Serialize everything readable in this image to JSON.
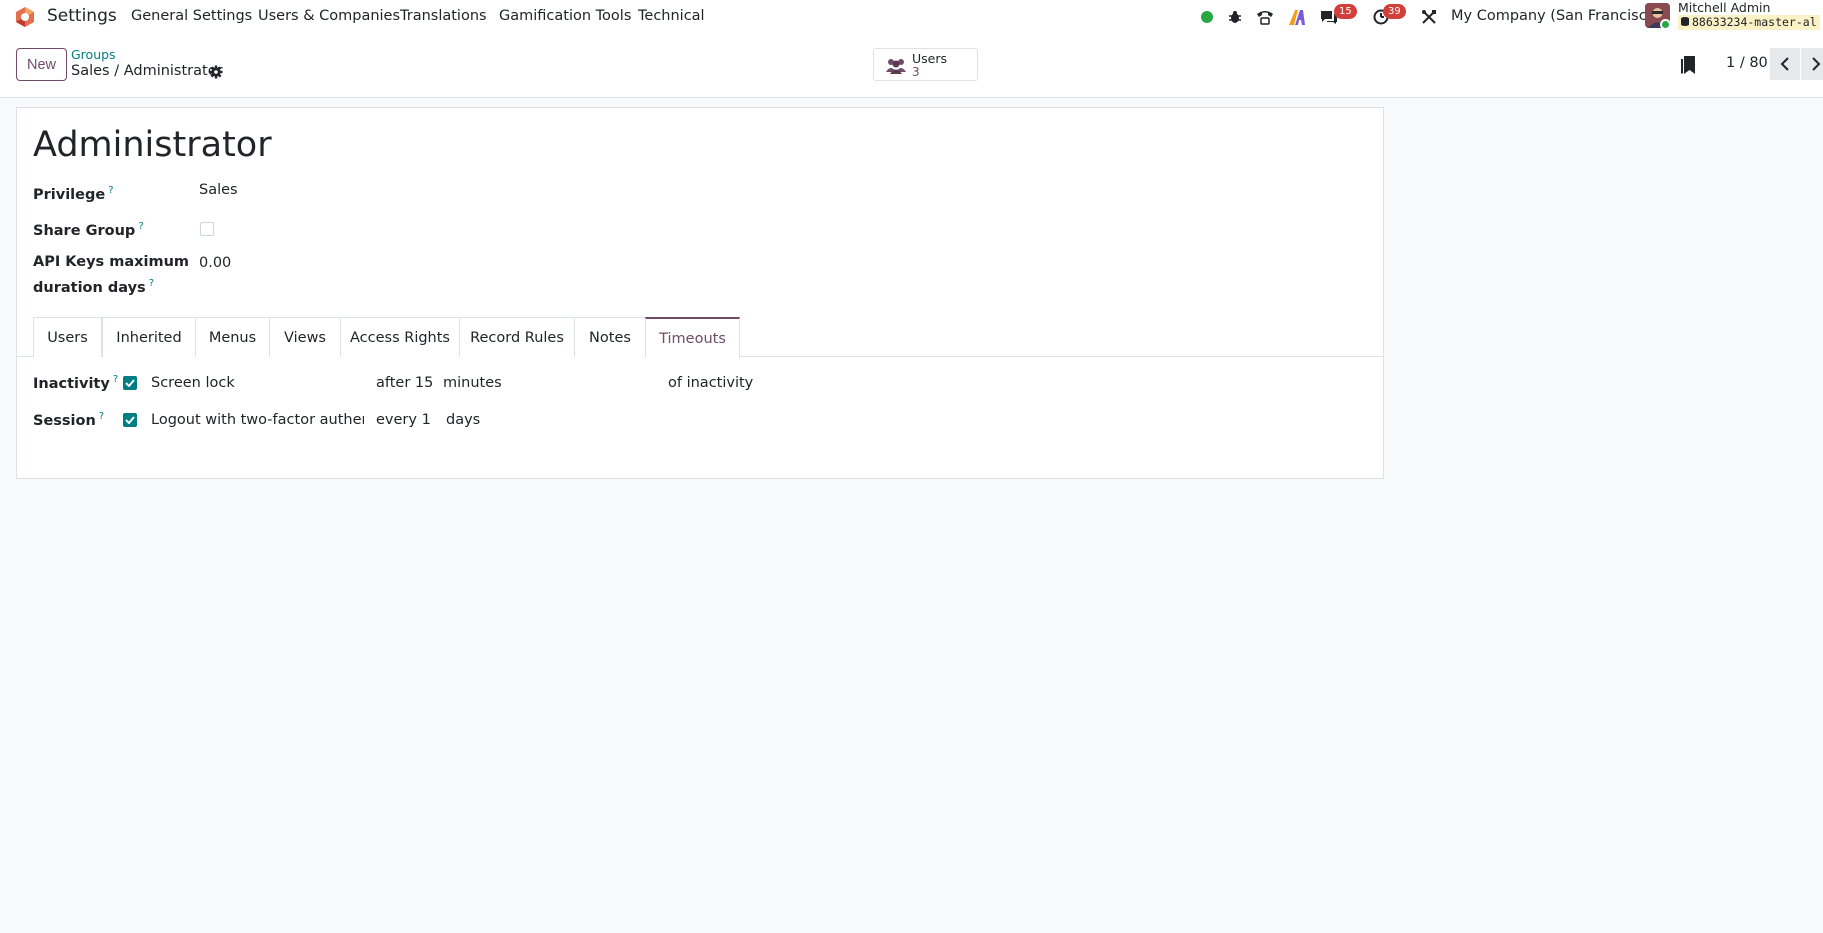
{
  "navbar": {
    "app_name": "Settings",
    "menu": [
      "General Settings",
      "Users & Companies",
      "Translations",
      "Gamification Tools",
      "Technical"
    ],
    "messages_count": "15",
    "activities_count": "39",
    "company": "My Company (San Francisco)",
    "user_name": "Mitchell Admin",
    "database": "88633234-master-al"
  },
  "control_panel": {
    "new_label": "New",
    "breadcrumb_parent": "Groups",
    "breadcrumb_current": "Sales / Administrator",
    "smart_button": {
      "label": "Users",
      "value": "3"
    },
    "pager": "1 / 80"
  },
  "form": {
    "title": "Administrator",
    "fields": [
      {
        "label": "Privilege",
        "tip": "?",
        "value": "Sales"
      },
      {
        "label": "Share Group",
        "tip": "?",
        "checked": false
      },
      {
        "label_line1": "API Keys maximum",
        "label_line2": "duration days",
        "tip": "?",
        "value": "0.00"
      }
    ],
    "tabs": [
      "Users",
      "Inherited",
      "Menus",
      "Views",
      "Access Rights",
      "Record Rules",
      "Notes",
      "Timeouts"
    ],
    "active_tab": "Timeouts",
    "timeouts": {
      "inactivity": {
        "label": "Inactivity",
        "tip": "?",
        "checked": true,
        "checkbox_label": "Screen lock",
        "prefix": "after 15",
        "unit": "minutes",
        "suffix": "of inactivity"
      },
      "session": {
        "label": "Session",
        "tip": "?",
        "checked": true,
        "checkbox_label": "Logout with two-factor authentication",
        "prefix": "every 1",
        "unit": "days"
      }
    }
  },
  "colors": {
    "brand": "#714b67",
    "link": "#017e84",
    "badge": "#d23f3a"
  }
}
